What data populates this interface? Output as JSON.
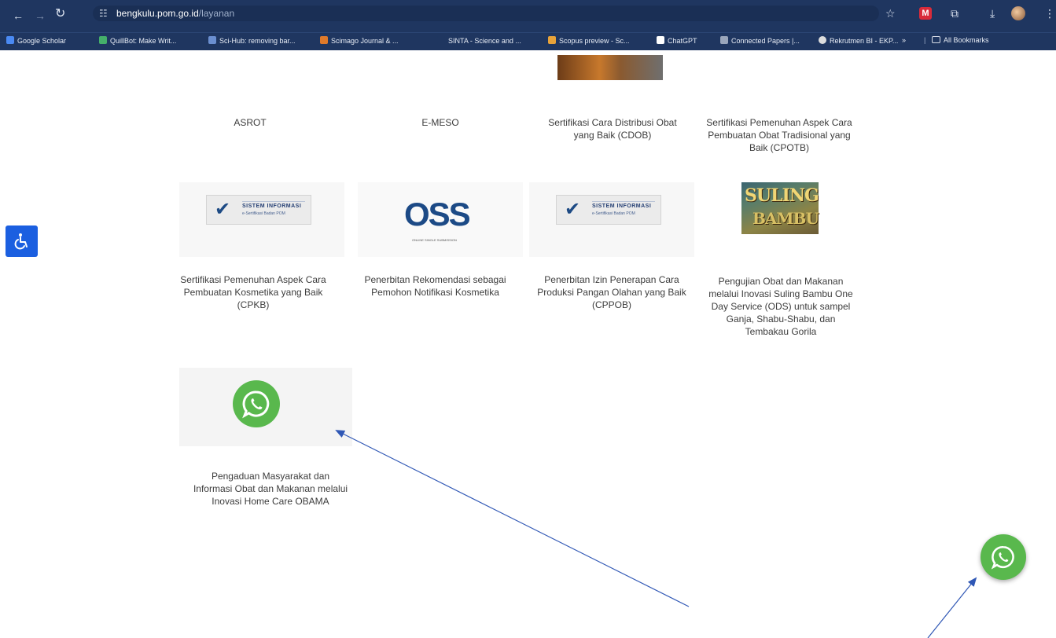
{
  "browser": {
    "url_host": "bengkulu.pom.go.id",
    "url_path": "/layanan",
    "bookmarks": [
      {
        "label": "Google Scholar",
        "color": "#4a8af4"
      },
      {
        "label": "QuillBot: Make Writ...",
        "color": "#45b06a"
      },
      {
        "label": "Sci-Hub: removing bar...",
        "color": "#6b8fd0"
      },
      {
        "label": "Scimago Journal & ...",
        "color": "#e07a2a"
      },
      {
        "label": "SINTA - Science and ...",
        "color": "#1f3660"
      },
      {
        "label": "Scopus preview - Sc...",
        "color": "#e8a33a"
      },
      {
        "label": "ChatGPT",
        "color": "#ffffff"
      },
      {
        "label": "Connected Papers |...",
        "color": "#9aa6bb"
      },
      {
        "label": "Rekrutmen BI - EKP...",
        "color": "#dddddd"
      },
      {
        "label": "All Bookmarks",
        "color": "#d8dde8"
      }
    ]
  },
  "services": {
    "row1": [
      {
        "title": "ASROT"
      },
      {
        "title": "E-MESO"
      },
      {
        "title": "Sertifikasi Cara Distribusi Obat yang Baik (CDOB)"
      },
      {
        "title": "Sertifikasi Pemenuhan Aspek Cara Pembuatan Obat Tradisional yang Baik (CPOTB)"
      }
    ],
    "row2": [
      {
        "title": "Sertifikasi Pemenuhan Aspek Cara Pembuatan Kosmetika yang Baik (CPKB)"
      },
      {
        "title": "Penerbitan Rekomendasi sebagai Pemohon Notifikasi Kosmetika"
      },
      {
        "title": "Penerbitan Izin Penerapan Cara Produksi Pangan Olahan yang Baik (CPPOB)"
      },
      {
        "title": "Pengujian Obat dan Makanan melalui Inovasi Suling Bambu One Day Service (ODS) untuk sampel Ganja, Shabu-Shabu, dan Tembakau Gorila"
      }
    ],
    "row3": [
      {
        "title": "Pengaduan Masyarakat dan Informasi Obat dan Makanan melalui Inovasi Home Care OBAMA"
      }
    ]
  },
  "logos": {
    "sertif_line1": "SISTEM INFORMASI",
    "sertif_line2": "e-Sertifikasi Badan POM",
    "oss": "OSS",
    "oss_sub": "ONLINE SINGLE SUBMISSION",
    "suling_line1": "SULING",
    "suling_line2": "BAMBU"
  },
  "colors": {
    "whatsapp": "#59b84d",
    "accessibility": "#1b5fe0",
    "annotation_arrow": "#2f57b5",
    "chrome": "#1f3660"
  }
}
